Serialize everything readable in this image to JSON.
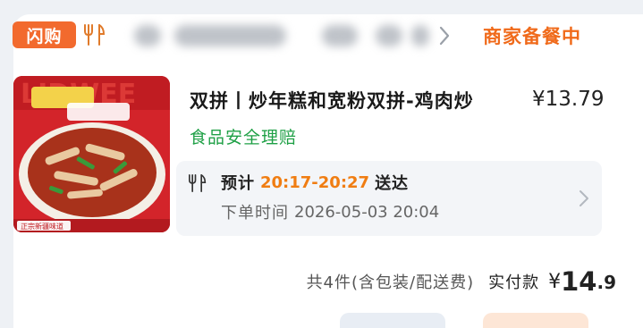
{
  "header": {
    "flash_badge": "闪购",
    "shop_status": "商家备餐中"
  },
  "product": {
    "title": "双拼丨炒年糕和宽粉双拼-鸡肉炒",
    "price": "¥13.79",
    "safety_tag": "食品安全理赔",
    "image_caption": "正宗新疆味道"
  },
  "delivery": {
    "eta_prefix": "预计",
    "eta_time": "20:17-20:27",
    "eta_suffix": "送达",
    "order_time_label": "下单时间",
    "order_time_value": "2026-05-03 20:04"
  },
  "summary": {
    "item_count_text": "共4件(含包装/配送费)",
    "paid_label": "实付款",
    "paid_currency": "¥",
    "paid_int": "14",
    "paid_dec": ".9"
  },
  "colors": {
    "accent_orange": "#f26a2e",
    "eta_orange": "#f07d12",
    "safety_green": "#1fa046"
  },
  "icons": [
    "fork-knife-icon",
    "chevron-right-icon"
  ]
}
